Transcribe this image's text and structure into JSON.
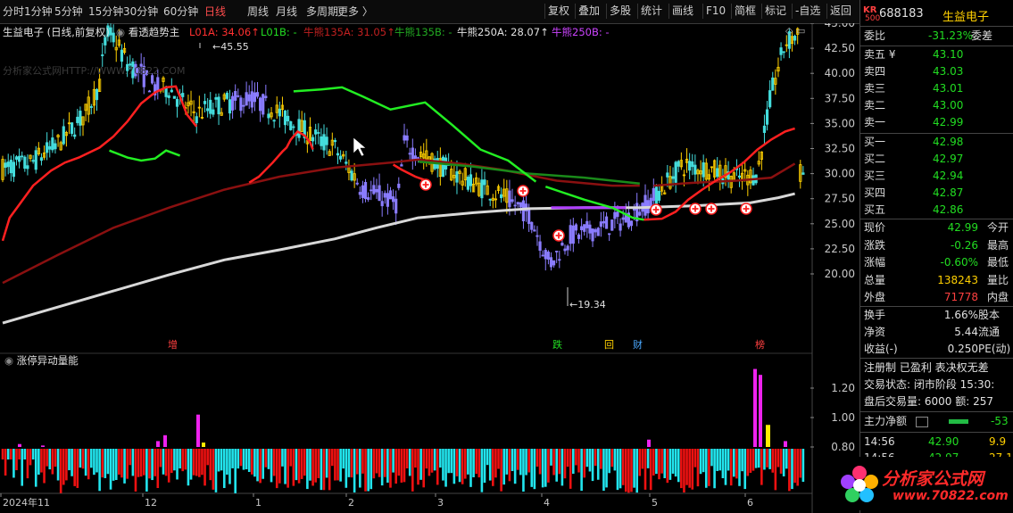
{
  "toolbar": {
    "left": [
      "分时",
      "1分钟",
      "5分钟",
      "15分钟",
      "30分钟",
      "60分钟",
      "日线",
      "周线",
      "月线",
      "多周期",
      "更多 〉"
    ],
    "active_index": 6,
    "right": [
      "复权",
      "叠加",
      "多股",
      "统计",
      "画线",
      "F10",
      "简框",
      "标记",
      "-自选",
      "返回"
    ]
  },
  "header": {
    "stock": "生益电子 (日线,前复权)",
    "indicator": "看透趋势主",
    "lines": [
      {
        "label": "L01A: 34.06↑",
        "color": "#ff3030"
      },
      {
        "label": "L01B: -",
        "color": "#22dd22"
      },
      {
        "label": "牛熊135A: 31.05↑",
        "color": "#c02020"
      },
      {
        "label": "牛熊135B: -",
        "color": "#22aa22"
      },
      {
        "label": "牛熊250A: 28.07↑",
        "color": "#e0e0e0"
      },
      {
        "label": "牛熊250B: -",
        "color": "#cc44ff"
      }
    ],
    "sub_indicator": "涨停异动量能"
  },
  "watermark": "分析家公式网HTTP://WWW.70822.COM",
  "annotations": {
    "high": "45.55",
    "low": "19.34"
  },
  "event_marks": [
    {
      "text": "增",
      "color": "#ff4040"
    },
    {
      "text": "跌",
      "color": "#22dd22"
    },
    {
      "text": "回",
      "color": "#ffd000"
    },
    {
      "text": "财",
      "color": "#4aa8ff"
    },
    {
      "text": "榜",
      "color": "#ff4040"
    }
  ],
  "right_panel": {
    "badge": "KR",
    "badge_sub": "500",
    "code": "688183",
    "name": "生益电子",
    "weibi": {
      "label": "委比",
      "value": "-31.23%",
      "extra": "委差"
    },
    "asks": [
      {
        "label": "卖五 ¥",
        "price": "43.10"
      },
      {
        "label": "卖四",
        "price": "43.03"
      },
      {
        "label": "卖三",
        "price": "43.01"
      },
      {
        "label": "卖二",
        "price": "43.00"
      },
      {
        "label": "卖一",
        "price": "42.99"
      }
    ],
    "bids": [
      {
        "label": "买一",
        "price": "42.98"
      },
      {
        "label": "买二",
        "price": "42.97"
      },
      {
        "label": "买三",
        "price": "42.94"
      },
      {
        "label": "买四",
        "price": "42.87"
      },
      {
        "label": "买五",
        "price": "42.86"
      }
    ],
    "stats": [
      {
        "label": "现价",
        "value": "42.99",
        "extra": "今开",
        "color": "#22dd22"
      },
      {
        "label": "涨跌",
        "value": "-0.26",
        "extra": "最高",
        "color": "#22dd22"
      },
      {
        "label": "涨幅",
        "value": "-0.60%",
        "extra": "最低",
        "color": "#22dd22"
      },
      {
        "label": "总量",
        "value": "138243",
        "extra": "量比",
        "color": "#ffd000"
      },
      {
        "label": "外盘",
        "value": "71778",
        "extra": "内盘",
        "color": "#ff4040"
      }
    ],
    "stats2": [
      {
        "label": "换手",
        "value": "1.66%",
        "extra": "股本"
      },
      {
        "label": "净资",
        "value": "5.44",
        "extra": "流通"
      },
      {
        "label": "收益(-)",
        "value": "0.250",
        "extra": "PE(动)"
      }
    ],
    "info": [
      "注册制 已盈利 表决权无差",
      "交易状态: 闭市阶段 15:30:",
      "盘后交易量: 6000 额: 257"
    ],
    "flow_label": "主力净额",
    "flow_value": "-53",
    "ticks": [
      {
        "time": "14:56",
        "price": "42.90",
        "vol": "9.9"
      },
      {
        "time": "14:56",
        "price": "42.97",
        "vol": "27.1"
      }
    ]
  },
  "brand": {
    "name": "分析家公式网",
    "url": "www.70822.com"
  },
  "chart_data": {
    "type": "candlestick",
    "price_axis": {
      "ticks": [
        45.0,
        42.5,
        40.0,
        37.5,
        35.0,
        32.5,
        30.0,
        27.5,
        25.0,
        22.5,
        20.0
      ]
    },
    "volume_axis": {
      "ticks": [
        1.2,
        1.0,
        0.8
      ]
    },
    "x_labels": [
      "2024年11",
      "12",
      "1",
      "2",
      "3",
      "4",
      "5",
      "6"
    ],
    "high_mark": 45.55,
    "low_mark": 19.34,
    "ma": {
      "L01A": [
        [
          0,
          23.3
        ],
        [
          5,
          25.6
        ],
        [
          12,
          26.9
        ],
        [
          22,
          28.8
        ],
        [
          35,
          30.3
        ],
        [
          45,
          31.1
        ],
        [
          55,
          31.6
        ],
        [
          70,
          32.6
        ],
        [
          80,
          33.7
        ],
        [
          90,
          35.2
        ],
        [
          100,
          37.0
        ],
        [
          110,
          38.1
        ],
        [
          118,
          38.6
        ],
        [
          125,
          38.7
        ],
        [
          128,
          37.7
        ],
        [
          133,
          35.9
        ],
        [
          140,
          34.7
        ]
      ],
      "L01A_down": [
        [
          178,
          29.1
        ],
        [
          185,
          29.7
        ],
        [
          195,
          31.1
        ],
        [
          202,
          32.2
        ],
        [
          205,
          32.6
        ],
        [
          208,
          33.4
        ],
        [
          213,
          34.2
        ],
        [
          218,
          33.8
        ],
        [
          222,
          33.1
        ],
        [
          224,
          32.4
        ]
      ],
      "L01A_low": [
        [
          282,
          30.9
        ],
        [
          288,
          30.4
        ],
        [
          298,
          29.7
        ],
        [
          308,
          29.2
        ]
      ],
      "L01A_end": [
        [
          463,
          25.4
        ],
        [
          476,
          25.5
        ],
        [
          486,
          26.2
        ],
        [
          495,
          27.4
        ],
        [
          505,
          28.4
        ],
        [
          515,
          29.3
        ],
        [
          525,
          30.1
        ],
        [
          535,
          31.1
        ],
        [
          545,
          32.4
        ],
        [
          555,
          33.4
        ],
        [
          565,
          34.2
        ],
        [
          572,
          34.5
        ]
      ],
      "L01B": [
        [
          77,
          32.3
        ],
        [
          90,
          31.6
        ],
        [
          100,
          31.3
        ],
        [
          110,
          31.5
        ],
        [
          118,
          32.3
        ],
        [
          128,
          31.8
        ]
      ],
      "L01B_mid": [
        [
          210,
          38.2
        ],
        [
          230,
          38.4
        ],
        [
          245,
          38.6
        ],
        [
          260,
          37.7
        ],
        [
          280,
          36.4
        ],
        [
          305,
          37.1
        ],
        [
          325,
          34.8
        ],
        [
          345,
          32.4
        ],
        [
          365,
          31.3
        ],
        [
          385,
          29.2
        ]
      ],
      "L01B_low": [
        [
          392,
          28.7
        ],
        [
          405,
          28.1
        ],
        [
          420,
          27.4
        ],
        [
          440,
          26.6
        ],
        [
          455,
          25.6
        ],
        [
          463,
          25.4
        ]
      ],
      "bull135A": [
        [
          0,
          19.1
        ],
        [
          40,
          21.9
        ],
        [
          80,
          24.6
        ],
        [
          120,
          26.6
        ],
        [
          160,
          28.4
        ],
        [
          200,
          29.7
        ],
        [
          240,
          30.6
        ],
        [
          280,
          31.1
        ],
        [
          300,
          31.4
        ],
        [
          330,
          31.0
        ],
        [
          360,
          30.4
        ],
        [
          400,
          29.3
        ],
        [
          440,
          28.8
        ],
        [
          460,
          28.8
        ]
      ],
      "bull135A_end": [
        [
          470,
          28.8
        ],
        [
          500,
          29.1
        ],
        [
          530,
          29.3
        ],
        [
          555,
          29.6
        ],
        [
          572,
          31.0
        ]
      ],
      "bull135B": [
        [
          300,
          31.2
        ],
        [
          340,
          30.7
        ],
        [
          380,
          30.0
        ],
        [
          420,
          29.6
        ],
        [
          460,
          29.0
        ]
      ],
      "bull250A": [
        [
          0,
          15.1
        ],
        [
          40,
          16.7
        ],
        [
          80,
          18.3
        ],
        [
          120,
          19.9
        ],
        [
          160,
          21.4
        ],
        [
          200,
          22.4
        ],
        [
          240,
          23.5
        ],
        [
          270,
          24.6
        ],
        [
          300,
          25.6
        ],
        [
          340,
          26.1
        ],
        [
          380,
          26.5
        ],
        [
          420,
          26.6
        ],
        [
          460,
          26.6
        ],
        [
          500,
          26.8
        ],
        [
          540,
          27.1
        ],
        [
          560,
          27.6
        ],
        [
          572,
          28.0
        ]
      ],
      "bull250B": [
        [
          396,
          26.6
        ],
        [
          420,
          26.6
        ],
        [
          450,
          26.6
        ]
      ]
    },
    "volume_reference": 0.8
  }
}
